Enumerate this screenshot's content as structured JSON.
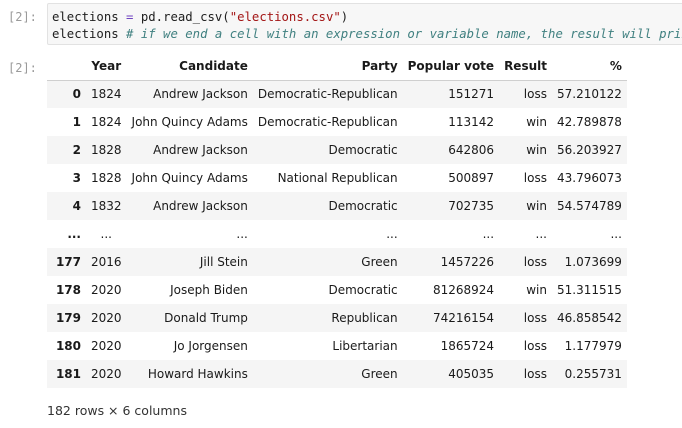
{
  "input_cell": {
    "prompt": "[2]:",
    "line1": {
      "var": "elections",
      "op": " = ",
      "func": "pd.read_csv(",
      "string": "\"elections.csv\"",
      "close": ")"
    },
    "line2": {
      "var": "elections",
      "comment": " # if we end a cell with an expression or variable name, the result will print"
    }
  },
  "output_cell": {
    "prompt": "[2]:",
    "columns": [
      "",
      "Year",
      "Candidate",
      "Party",
      "Popular vote",
      "Result",
      "%"
    ],
    "rows": [
      [
        "0",
        "1824",
        "Andrew Jackson",
        "Democratic-Republican",
        "151271",
        "loss",
        "57.210122"
      ],
      [
        "1",
        "1824",
        "John Quincy Adams",
        "Democratic-Republican",
        "113142",
        "win",
        "42.789878"
      ],
      [
        "2",
        "1828",
        "Andrew Jackson",
        "Democratic",
        "642806",
        "win",
        "56.203927"
      ],
      [
        "3",
        "1828",
        "John Quincy Adams",
        "National Republican",
        "500897",
        "loss",
        "43.796073"
      ],
      [
        "4",
        "1832",
        "Andrew Jackson",
        "Democratic",
        "702735",
        "win",
        "54.574789"
      ],
      [
        "...",
        "...",
        "...",
        "...",
        "...",
        "...",
        "..."
      ],
      [
        "177",
        "2016",
        "Jill Stein",
        "Green",
        "1457226",
        "loss",
        "1.073699"
      ],
      [
        "178",
        "2020",
        "Joseph Biden",
        "Democratic",
        "81268924",
        "win",
        "51.311515"
      ],
      [
        "179",
        "2020",
        "Donald Trump",
        "Republican",
        "74216154",
        "loss",
        "46.858542"
      ],
      [
        "180",
        "2020",
        "Jo Jorgensen",
        "Libertarian",
        "1865724",
        "loss",
        "1.177979"
      ],
      [
        "181",
        "2020",
        "Howard Hawkins",
        "Green",
        "405035",
        "loss",
        "0.255731"
      ]
    ],
    "shape_text": "182 rows × 6 columns"
  }
}
